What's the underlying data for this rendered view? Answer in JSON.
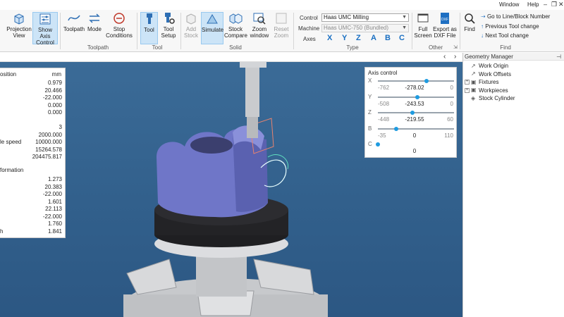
{
  "menus": {
    "window": "Window",
    "help": "Help"
  },
  "window_controls": {
    "restore": "⎘",
    "maximize": "❐",
    "close": "✕"
  },
  "ribbon": {
    "buttons": {
      "projection": "Projection View",
      "show_axis": "Show Axis Control",
      "toolpath": "Toolpath",
      "mode": "Mode",
      "stop_conditions": "Stop Conditions",
      "tool": "Tool",
      "tool_setup": "Tool Setup",
      "add_stock": "Add Stock",
      "simulate": "Simulate",
      "stock_compare": "Stock Compare",
      "zoom_window": "Zoom window",
      "reset_zoom": "Reset Zoom",
      "full_screen": "Full Screen",
      "export_dxf": "Export as DXF File",
      "find": "Find"
    },
    "groups": {
      "toolpath": "Toolpath",
      "tool": "Tool",
      "solid": "Solid",
      "type": "Type",
      "other": "Other",
      "find": "Find"
    },
    "control_label": "Control",
    "control_value": "Haas UMC Milling",
    "machine_label": "Machine",
    "machine_value": "Haas UMC-750 (Bundled)",
    "axes_label": "Axes",
    "axes": [
      "X",
      "Y",
      "Z",
      "A",
      "B",
      "C"
    ],
    "find_items": [
      "Go to Line/Block Number",
      "Previous Tool change",
      "Next Tool change"
    ]
  },
  "geometry_manager": {
    "title": "Geometry Manager",
    "items": [
      {
        "label": "Work Origin",
        "expandable": false
      },
      {
        "label": "Work Offsets",
        "expandable": false
      },
      {
        "label": "Fixtures",
        "expandable": true
      },
      {
        "label": "Workpieces",
        "expandable": true
      },
      {
        "label": "Stock Cylinder",
        "expandable": false
      }
    ]
  },
  "position_panel": {
    "header": "osition",
    "unit": "mm",
    "rows": [
      {
        "label": "",
        "value": "0.979"
      },
      {
        "label": "",
        "value": "20.466"
      },
      {
        "label": "",
        "value": "-22.000"
      },
      {
        "label": "",
        "value": "0.000"
      },
      {
        "label": "",
        "value": "0.000"
      },
      {
        "label": "",
        "value": ""
      },
      {
        "label": "",
        "value": "3"
      },
      {
        "label": "",
        "value": "2000.000"
      },
      {
        "label": "le speed",
        "value": "10000.000"
      },
      {
        "label": "",
        "value": "15264.578"
      },
      {
        "label": "",
        "value": "204475.817"
      }
    ],
    "info_header": "formation",
    "info_rows": [
      {
        "label": "",
        "value": "1.273"
      },
      {
        "label": "",
        "value": "20.383"
      },
      {
        "label": "",
        "value": "-22.000"
      },
      {
        "label": "",
        "value": "1.601"
      },
      {
        "label": "",
        "value": "22.113"
      },
      {
        "label": "",
        "value": "-22.000"
      },
      {
        "label": "",
        "value": "1.760"
      },
      {
        "label": "h",
        "value": "1.841"
      }
    ]
  },
  "axis_control": {
    "title": "Axis control",
    "axes": [
      {
        "name": "X",
        "min": "-762",
        "current": "-278.02",
        "max": "0",
        "fraction": 0.64
      },
      {
        "name": "Y",
        "min": "-508",
        "current": "-243.53",
        "max": "0",
        "fraction": 0.52
      },
      {
        "name": "Z",
        "min": "-448",
        "current": "-219.55",
        "max": "60",
        "fraction": 0.45
      },
      {
        "name": "B",
        "min": "-35",
        "current": "0",
        "max": "110",
        "fraction": 0.24
      },
      {
        "name": "C",
        "min": "",
        "current": "0",
        "max": "",
        "fraction": 0.0
      }
    ]
  },
  "colors": {
    "accent": "#1e9be0",
    "viewport": "#326090",
    "part": "#6f76c8",
    "fixture": "#1f1f22"
  }
}
